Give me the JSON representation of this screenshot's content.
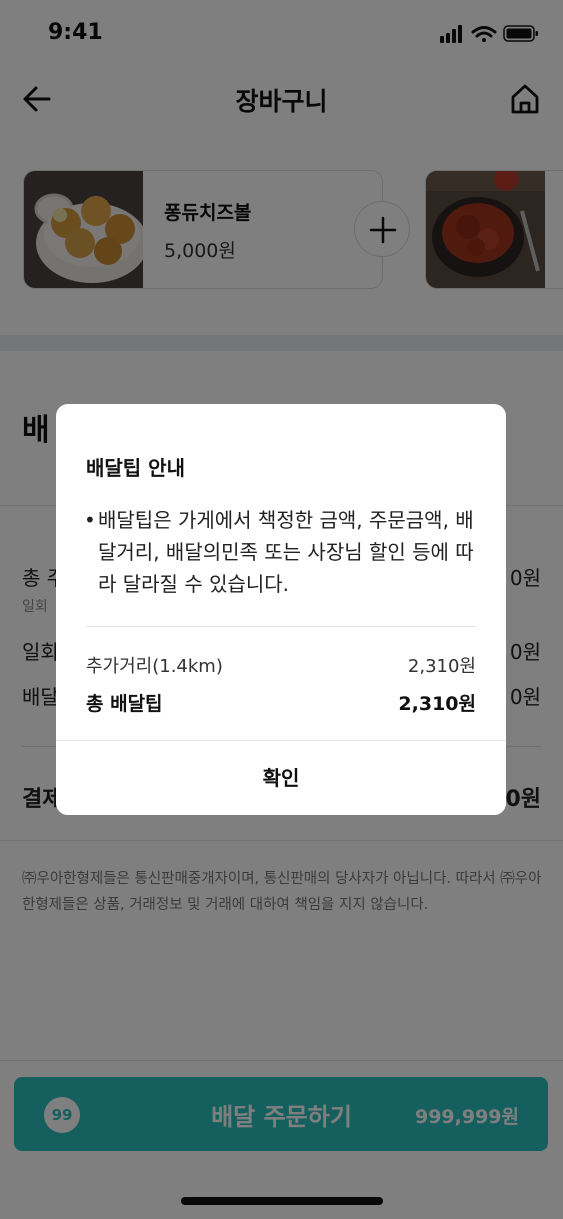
{
  "status_bar": {
    "time": "9:41"
  },
  "header": {
    "title": "장바구니"
  },
  "cart_items": [
    {
      "name": "퐁듀치즈볼",
      "price": "5,000원"
    }
  ],
  "summary": {
    "section_title": "배",
    "row1_label": "총 주",
    "row1_sub": "일회",
    "row1_value": "0원",
    "row2_label": "일회",
    "row2_value": "0원",
    "row3_label": "배달",
    "row3_value": "0원",
    "pay_label": "결제",
    "pay_value": "0원"
  },
  "disclaimer": "㈜우아한형제들은 통신판매중개자이며, 통신판매의 당사자가 아닙니다. 따라서 ㈜우아한형제들은 상품, 거래정보 및 거래에 대하여 책임을 지지 않습니다.",
  "order_button": {
    "count": "99",
    "label": "배달 주문하기",
    "price": "999,999원"
  },
  "modal": {
    "title": "배달팁 안내",
    "bullet": "•",
    "body": "배달팁은 가게에서 책정한 금액, 주문금액, 배달거리, 배달의민족 또는 사장님 할인 등에 따라 달라질 수 있습니다.",
    "extra_label": "추가거리(1.4km)",
    "extra_value": "2,310원",
    "total_label": "총 배달팁",
    "total_value": "2,310원",
    "confirm_label": "확인"
  },
  "colors": {
    "accent": "#2ac1bc",
    "overlay": "rgba(0,0,0,0.5)"
  },
  "icons": [
    "back-arrow-icon",
    "home-icon",
    "plus-icon",
    "signal-icon",
    "wifi-icon",
    "battery-icon"
  ]
}
